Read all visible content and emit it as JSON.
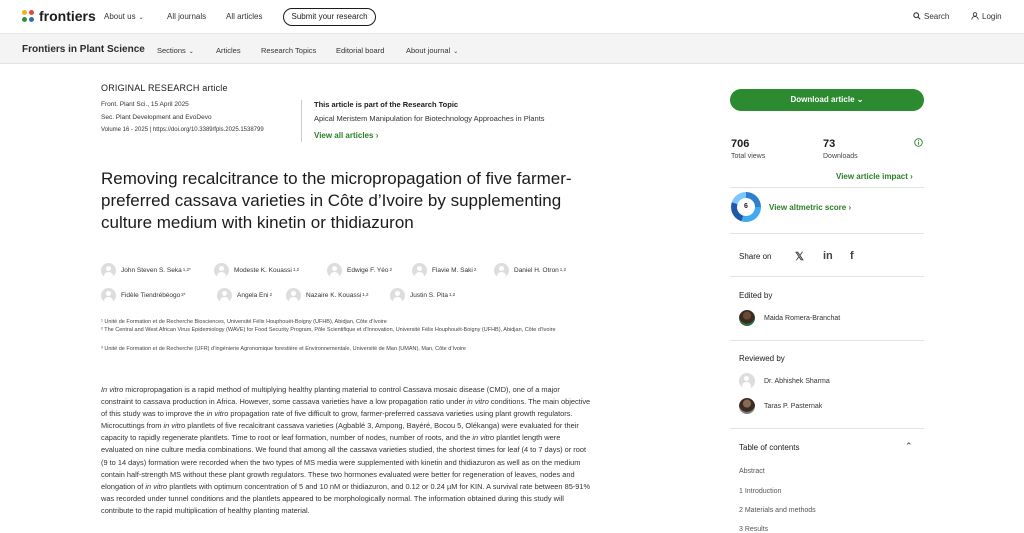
{
  "topbar": {
    "brand": "frontiers",
    "nav": [
      "About us",
      "All journals",
      "All articles"
    ],
    "submit_label": "Submit your research",
    "search_label": "Search",
    "login_label": "Login"
  },
  "secondary_nav": {
    "journal": "Frontiers in Plant Science",
    "items": [
      "Sections",
      "Articles",
      "Research Topics",
      "Editorial board",
      "About journal"
    ]
  },
  "article": {
    "type": "ORIGINAL RESEARCH article",
    "citation": "Front. Plant Sci., 15 April 2025",
    "section": "Sec. Plant Development and EvoDevo",
    "volume_doi": "Volume 16 - 2025 | https://doi.org/10.3389/fpls.2025.1538799",
    "research_topic_heading": "This article is part of the Research Topic",
    "research_topic_title": "Apical Meristem Manipulation for Biotechnology Approaches in Plants",
    "view_all_label": "View all articles",
    "title": "Removing recalcitrance to the micropropagation of five farmer-preferred cassava varieties in Côte d’Ivoire by supplementing culture medium with kinetin or thidiazuron",
    "authors": [
      {
        "name": "John Steven S. Seka",
        "sup": "1,2*"
      },
      {
        "name": "Modeste K. Kouassi",
        "sup": "1,2"
      },
      {
        "name": "Edwige F. Yéo",
        "sup": "2"
      },
      {
        "name": "Flavie M. Saki",
        "sup": "2"
      },
      {
        "name": "Daniel H. Otron",
        "sup": "1,2"
      },
      {
        "name": "Fidèle Tiendrébéogo",
        "sup": "2*"
      },
      {
        "name": "Angela Eni",
        "sup": "2"
      },
      {
        "name": "Nazaire K. Kouassi",
        "sup": "1,2"
      },
      {
        "name": "Justin S. Pita",
        "sup": "1,2"
      }
    ],
    "affiliations": [
      "¹ Unité de Formation et de Recherche Biosciences, Université Félix Houphouët-Boigny (UFHB), Abidjan, Côte d’Ivoire",
      "² The Central and West African Virus Epidemiology (WAVE) for Food Security Program, Pôle Scientifique et d’Innovation, Université Félix Houphouët-Boigny (UFHB), Abidjan, Côte d’Ivoire",
      "³ Unité de Formation et de Recherche (UFR) d’ingénierie Agronomique forestière et Environnementale, Université de Man (UMAN), Man, Côte d’Ivoire"
    ],
    "abstract": [
      {
        "t": "In vitro",
        "i": true
      },
      {
        "t": " micropropagation is a rapid method of multiplying healthy planting material to control Cassava mosaic disease (CMD), one of a major constraint to cassava production in Africa. However, some cassava varieties have a low propagation ratio under ",
        "i": false
      },
      {
        "t": "in vitro",
        "i": true
      },
      {
        "t": " conditions. The main objective of this study was to improve the ",
        "i": false
      },
      {
        "t": "in vitro",
        "i": true
      },
      {
        "t": " propagation rate of five difficult to grow, farmer-preferred cassava varieties using plant growth regulators. Microcuttings from ",
        "i": false
      },
      {
        "t": "in vitro",
        "i": true
      },
      {
        "t": " plantlets of five recalcitrant cassava varieties (Agbablé 3, Ampong, Bayéré, Bocou 5, Olékanga) were evaluated for their capacity to rapidly regenerate plantlets. Time to root or leaf formation, number of nodes, number of roots, and the ",
        "i": false
      },
      {
        "t": "in vitro",
        "i": true
      },
      {
        "t": " plantlet length were evaluated on nine culture media combinations. We found that among all the cassava varieties studied, the shortest times for leaf (4 to 7 days) or root (9 to 14 days) formation were recorded when the two types of MS media were supplemented with kinetin and thidiazuron as well as on the medium contain half-strength MS without these plant growth regulators. These two hormones evaluated were better for regeneration of leaves, nodes and elongation of ",
        "i": false
      },
      {
        "t": "in vitro",
        "i": true
      },
      {
        "t": " plantlets with optimum concentration of 5 and 10 nM or thidiazuron, and 0.12 or 0.24 µM for KIN. A survival rate between 85-91% was recorded under tunnel conditions and the plantlets appeared to be morphologically normal. The information obtained during this study will contribute to the rapid multiplication of healthy planting material.",
        "i": false
      }
    ]
  },
  "sidebar": {
    "download_label": "Download article",
    "views_num": "706",
    "views_label": "Total views",
    "downloads_num": "73",
    "downloads_label": "Downloads",
    "impact_label": "View article impact",
    "altmetric_score": "6",
    "altmetric_label": "View altmetric score",
    "share_label": "Share on",
    "edited_by": "Edited by",
    "editor": "Maida Romera-Branchat",
    "reviewed_by": "Reviewed by",
    "reviewers": [
      "Dr. Abhishek Sharma",
      "Taras P. Pasternak"
    ],
    "toc_heading": "Table of contents",
    "toc": [
      "Abstract",
      "1 Introduction",
      "2 Materials and methods",
      "3 Results"
    ]
  },
  "colors": {
    "accent_green": "#2c8a30",
    "link_green": "#2a7f28"
  }
}
